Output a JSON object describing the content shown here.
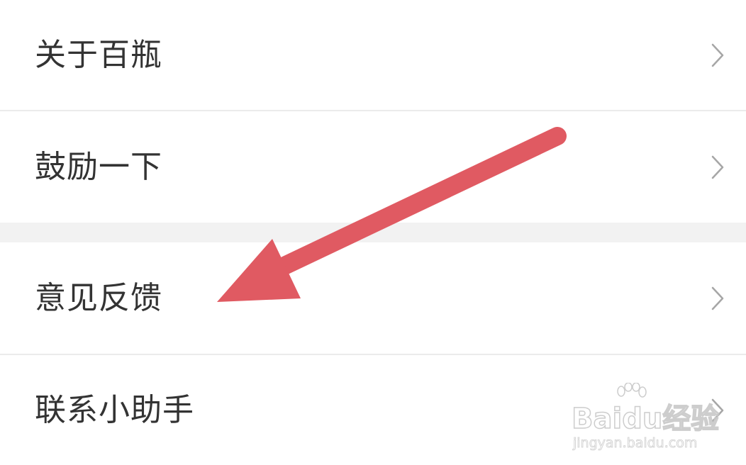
{
  "menu": {
    "group1": [
      {
        "label": "关于百瓶"
      },
      {
        "label": "鼓励一下"
      }
    ],
    "group2": [
      {
        "label": "意见反馈"
      },
      {
        "label": "联系小助手"
      }
    ]
  },
  "annotation": {
    "arrow_color": "#e05a62",
    "arrow_points_to": "意见反馈"
  },
  "watermark": {
    "logo": "Baidu经验",
    "url": "jingyan.baidu.com"
  },
  "colors": {
    "text": "#333333",
    "chevron": "#a6a6a6",
    "divider": "#ebebeb",
    "section_gap": "#f2f2f2",
    "arrow": "#e05a62"
  }
}
